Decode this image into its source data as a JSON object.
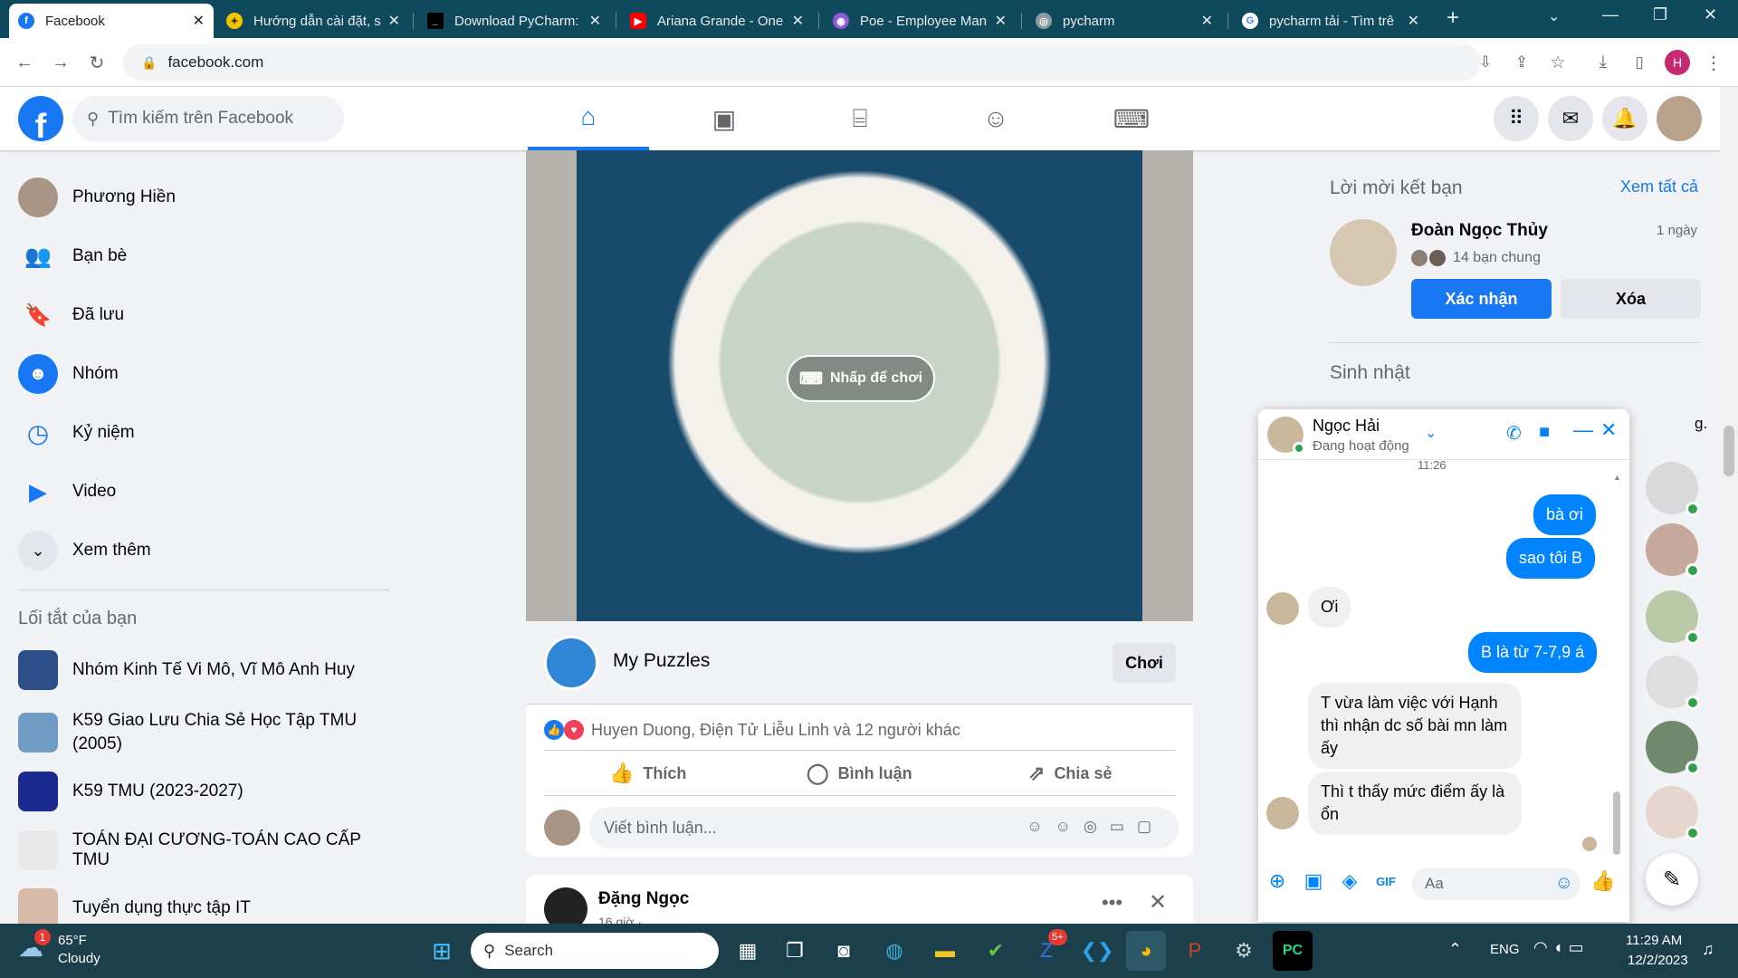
{
  "browser": {
    "tabs": [
      {
        "title": "Facebook",
        "active": true
      },
      {
        "title": "Hướng dẫn cài đặt, s"
      },
      {
        "title": "Download PyCharm:"
      },
      {
        "title": "Ariana Grande - One"
      },
      {
        "title": "Poe - Employee Man"
      },
      {
        "title": "pycharm"
      },
      {
        "title": "pycharm tải - Tìm trê"
      }
    ],
    "url": "facebook.com",
    "profile_initial": "H"
  },
  "fb": {
    "logo": "f",
    "search_placeholder": "Tìm kiếm trên Facebook",
    "sidebar": {
      "items": [
        {
          "label": "Phương Hiền",
          "icon": "avatar"
        },
        {
          "label": "Bạn bè",
          "icon": "friends-icon"
        },
        {
          "label": "Đã lưu",
          "icon": "bookmark-icon"
        },
        {
          "label": "Nhóm",
          "icon": "groups-icon"
        },
        {
          "label": "Kỷ niệm",
          "icon": "memories-icon"
        },
        {
          "label": "Video",
          "icon": "video-icon"
        },
        {
          "label": "Xem thêm",
          "icon": "chevron-down-icon"
        }
      ],
      "shortcuts_title": "Lối tắt của bạn",
      "shortcuts": [
        "Nhóm Kinh Tế Vi Mô, Vĩ Mô Anh Huy",
        "K59 Giao Lưu Chia Sẻ Học Tập TMU (2005)",
        "K59 TMU (2023-2027)",
        "TOÁN ĐẠI CƯƠNG-TOÁN CAO CẤP TMU",
        "Tuyển dụng thực tập IT"
      ]
    },
    "post": {
      "play_label": "Nhấp để chơi",
      "game_name": "My Puzzles",
      "play_button": "Chơi",
      "reactions": "Huyen Duong, Điện Tử Liễu Linh và 12 người khác",
      "like": "Thích",
      "comment": "Bình luận",
      "share": "Chia sẻ",
      "comment_placeholder": "Viết bình luận..."
    },
    "post2": {
      "author": "Đặng Ngọc",
      "time": "16 giờ ·"
    },
    "right": {
      "friend_requests_title": "Lời mời kết bạn",
      "see_all": "Xem tất cả",
      "requester": "Đoàn Ngọc Thủy",
      "request_time": "1 ngày",
      "mutual": "14 bạn chung",
      "confirm": "Xác nhận",
      "delete": "Xóa",
      "birthday_title": "Sinh nhật",
      "birthday_tail": "g."
    },
    "chat": {
      "name": "Ngọc Hải",
      "status": "Đang hoạt động",
      "time": "11:26",
      "messages": [
        {
          "from": "me",
          "text": "bà ơi"
        },
        {
          "from": "me",
          "text": "sao tôi B"
        },
        {
          "from": "them",
          "text": "Ơi"
        },
        {
          "from": "me",
          "text": "B là từ 7-7,9 á"
        },
        {
          "from": "them",
          "text": "T vừa làm việc với Hạnh thì nhận dc số bài mn làm ấy"
        },
        {
          "from": "them",
          "text": "Thì t thấy mức điểm ấy là ổn"
        }
      ],
      "input_placeholder": "Aa"
    }
  },
  "taskbar": {
    "weather_temp": "65°F",
    "weather_desc": "Cloudy",
    "weather_badge": "1",
    "search": "Search",
    "zalo_badge": "5+",
    "lang": "ENG",
    "time": "11:29 AM",
    "date": "12/2/2023"
  },
  "colors": {
    "fb_blue": "#1877f2",
    "messenger_blue": "#0084ff",
    "tabbar": "#0e4a5c",
    "taskbar": "#1c3f4c"
  }
}
